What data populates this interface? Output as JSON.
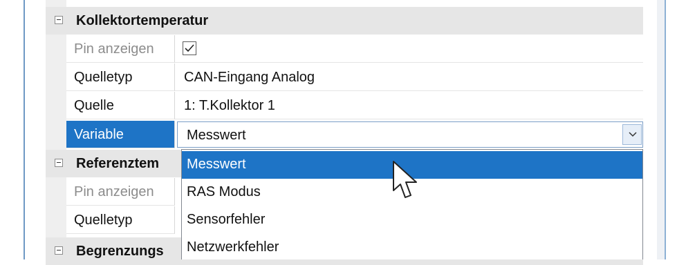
{
  "categories": {
    "kollektortemperatur": "Kollektortemperatur",
    "referenztemperatur": "Referenztem",
    "begrenzung": "Begrenzungs"
  },
  "rows": {
    "pin_anzeigen_1": {
      "label": "Pin anzeigen",
      "checked": true
    },
    "quelletyp_1": {
      "label": "Quelletyp",
      "value": "CAN-Eingang Analog"
    },
    "quelle": {
      "label": "Quelle",
      "value": "1: T.Kollektor 1"
    },
    "variable": {
      "label": "Variable",
      "value": "Messwert"
    },
    "pin_anzeigen_2": {
      "label": "Pin anzeigen"
    },
    "quelletyp_2": {
      "label": "Quelletyp"
    }
  },
  "dropdown": {
    "options": [
      "Messwert",
      "RAS Modus",
      "Sensorfehler",
      "Netzwerkfehler"
    ],
    "highlighted": "Messwert"
  },
  "colors": {
    "selection": "#1e74c6",
    "category_bg": "#e6e6e6",
    "window_border": "#6e98c4"
  }
}
